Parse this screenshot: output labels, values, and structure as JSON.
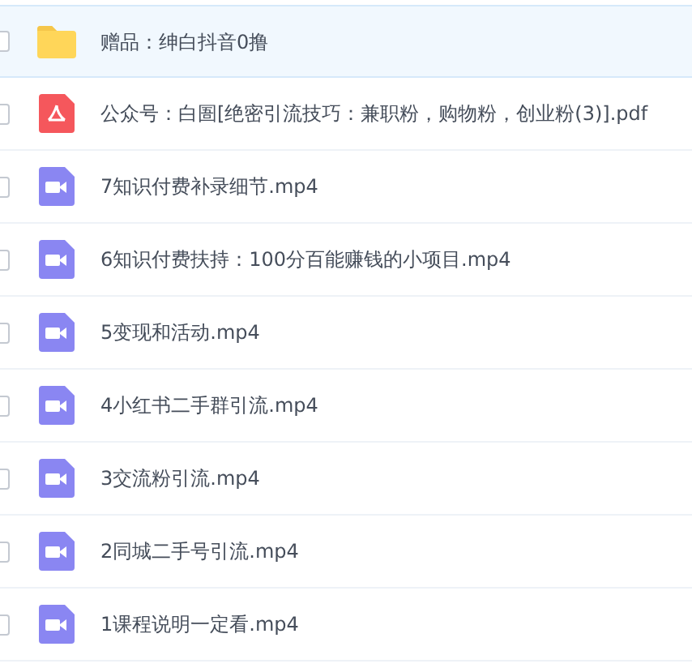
{
  "files": [
    {
      "kind": "folder",
      "name": "赠品：绅白抖音0撸",
      "selected": true,
      "checked": false
    },
    {
      "kind": "pdf",
      "name": "公众号：白圄[绝密引流技巧：兼职粉，购物粉，创业粉(3)].pdf",
      "selected": false,
      "checked": false
    },
    {
      "kind": "video",
      "name": "7知识付费补录细节.mp4",
      "selected": false,
      "checked": false
    },
    {
      "kind": "video",
      "name": "6知识付费扶持：100分百能赚钱的小项目.mp4",
      "selected": false,
      "checked": false
    },
    {
      "kind": "video",
      "name": "5变现和活动.mp4",
      "selected": false,
      "checked": false
    },
    {
      "kind": "video",
      "name": "4小红书二手群引流.mp4",
      "selected": false,
      "checked": false
    },
    {
      "kind": "video",
      "name": "3交流粉引流.mp4",
      "selected": false,
      "checked": false
    },
    {
      "kind": "video",
      "name": "2同城二手号引流.mp4",
      "selected": false,
      "checked": false
    },
    {
      "kind": "video",
      "name": "1课程说明一定看.mp4",
      "selected": false,
      "checked": false
    }
  ]
}
